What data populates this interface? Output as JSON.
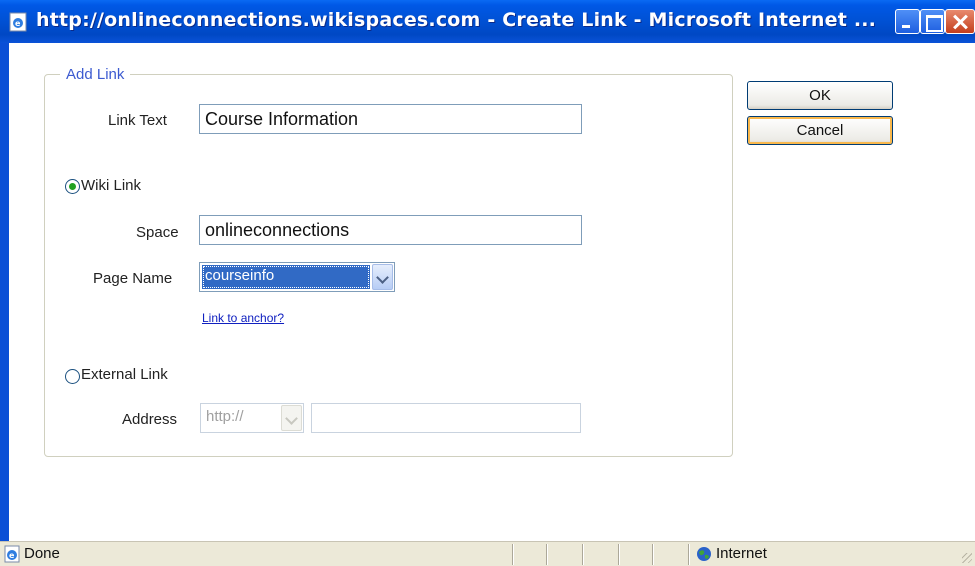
{
  "window": {
    "title": "http://onlineconnections.wikispaces.com - Create Link - Microsoft Internet ..."
  },
  "form": {
    "legend": "Add Link",
    "link_text_label": "Link Text",
    "link_text_value": "Course Information",
    "wiki_link_label": "Wiki Link",
    "wiki_link_selected": true,
    "space_label": "Space",
    "space_value": "onlineconnections",
    "page_name_label": "Page Name",
    "page_name_value": "courseinfo",
    "anchor_link": "Link to anchor?",
    "external_link_label": "External Link",
    "external_link_selected": false,
    "address_label": "Address",
    "address_protocol": "http://",
    "address_value": ""
  },
  "buttons": {
    "ok": "OK",
    "cancel": "Cancel"
  },
  "statusbar": {
    "status": "Done",
    "zone": "Internet"
  },
  "icons": {
    "title": "ie-page-icon",
    "status": "ie-icon",
    "zone": "globe-icon"
  },
  "colors": {
    "titlebar": "#0052d6",
    "selection": "#316ac5",
    "legend": "#3c5ad0",
    "link": "#1020c0"
  }
}
